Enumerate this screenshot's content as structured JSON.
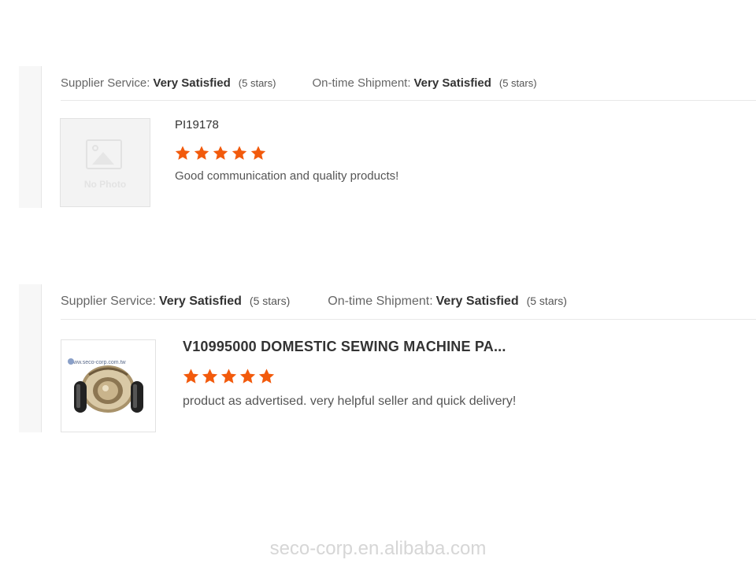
{
  "reviews": [
    {
      "supplier_service_label": "Supplier Service:",
      "supplier_service_value": "Very Satisfied",
      "supplier_service_count": "(5 stars)",
      "shipment_label": "On-time Shipment:",
      "shipment_value": "Very Satisfied",
      "shipment_count": "(5 stars)",
      "thumbnail": {
        "type": "placeholder",
        "text": "No Photo"
      },
      "product_title": "PI19178",
      "rating_stars": 5,
      "comment": "Good communication and quality products!"
    },
    {
      "supplier_service_label": "Supplier Service:",
      "supplier_service_value": "Very Satisfied",
      "supplier_service_count": "(5 stars)",
      "shipment_label": "On-time Shipment:",
      "shipment_value": "Very Satisfied",
      "shipment_count": "(5 stars)",
      "thumbnail": {
        "type": "product-photo",
        "text": "www.seco-corp.com.tw"
      },
      "product_title": "V10995000 DOMESTIC SEWING MACHINE PA...",
      "rating_stars": 5,
      "comment": "product as advertised. very helpful seller and quick delivery!"
    }
  ],
  "watermark": "seco-corp.en.alibaba.com",
  "colors": {
    "star": "#f25a0c",
    "divider": "#e8e8e8",
    "gutter": "#f7f7f7"
  }
}
